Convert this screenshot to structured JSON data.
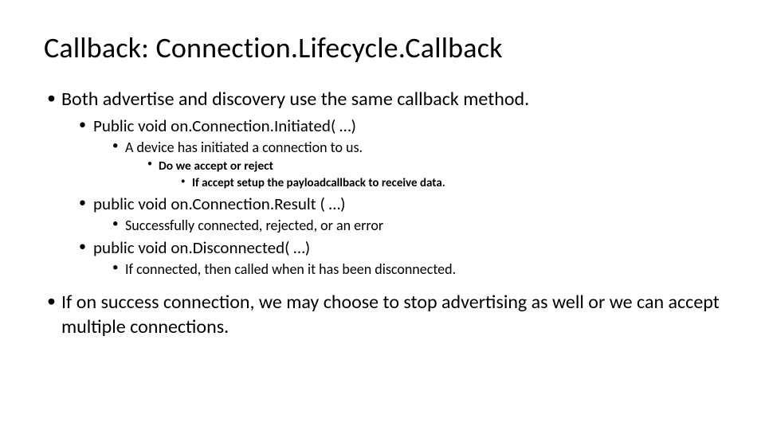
{
  "title": "Callback:  Connection.Lifecycle.Callback",
  "bullets": {
    "b1": "Both advertise and discovery use the same callback method.",
    "b1_1": "Public void on.Connection.Initiated( …)",
    "b1_1_1": "A device has initiated a connection to us.",
    "b1_1_1_1": "Do we accept or reject",
    "b1_1_1_1_1": "If accept setup the payloadcallback to receive data.",
    "b1_2": "public void on.Connection.Result ( …)",
    "b1_2_1": "Successfully connected, rejected, or an error",
    "b1_3": "public void on.Disconnected( …)",
    "b1_3_1": "If connected, then called when it has been disconnected.",
    "b2": "If on success connection, we may choose to stop advertising as well or we can accept multiple connections."
  }
}
